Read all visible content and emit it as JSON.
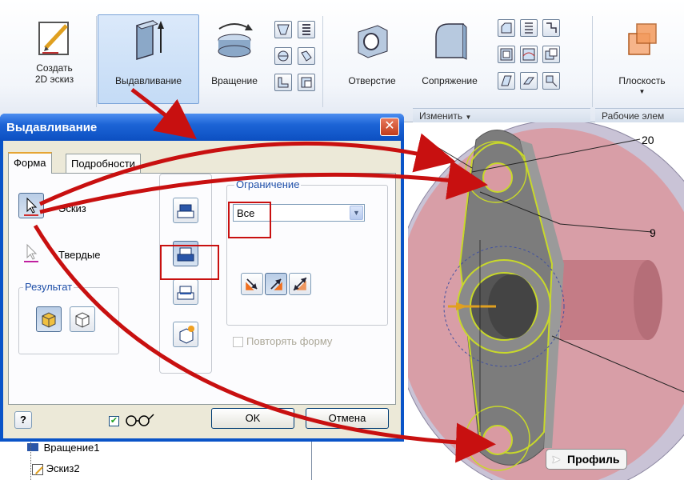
{
  "ribbon": {
    "create_sketch": "Создать\n2D эскиз",
    "extrude": "Выдавливание",
    "revolve": "Вращение",
    "hole": "Отверстие",
    "fillet": "Сопряжение",
    "plane": "Плоскость",
    "group_modify": "Изменить",
    "group_work": "Рабочие элем"
  },
  "dialog": {
    "title": "Выдавливание",
    "close_glyph": "✕",
    "tabs": [
      "Форма",
      "Подробности"
    ],
    "sketch_label": "Эскиз",
    "solids_label": "Твердые",
    "result_legend": "Результат",
    "extents_legend": "Ограничение",
    "extents_value": "Все",
    "repeat_shape": "Повторять форму",
    "help_glyph": "?",
    "ok": "OK",
    "cancel": "Отмена"
  },
  "view": {
    "dim_20": "20",
    "dim_9": "9",
    "profile_tag": "Профиль"
  },
  "browser": {
    "item1": "Вращение1",
    "item2": "Эскиз2"
  },
  "colors": {
    "annotation_red": "#c81010",
    "title_blue": "#0c4fc1",
    "model_pink": "#d99aa2",
    "sketch_green": "#c8d82a"
  }
}
